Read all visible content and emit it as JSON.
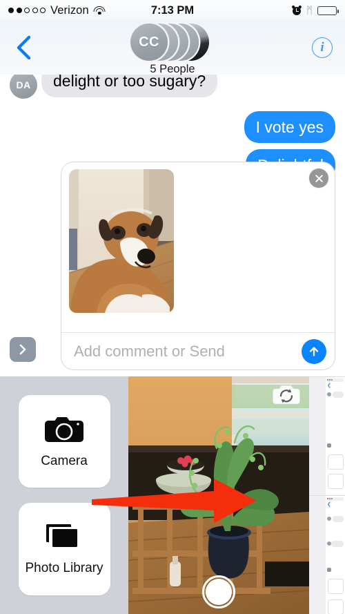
{
  "status_bar": {
    "carrier": "Verizon",
    "signal_dots_filled": 2,
    "signal_dots_total": 5,
    "wifi_icon": "wifi-icon",
    "time": "7:13 PM",
    "alarm_icon": "alarm-clock-icon",
    "bluetooth_icon": "bluetooth-icon",
    "bluetooth_glyph": "ᛗ",
    "battery_icon": "battery-low-icon",
    "battery_percent": 15,
    "battery_color": "#ef3a36"
  },
  "nav_bar": {
    "back_icon": "back-chevron-icon",
    "back_color": "#0a84ff",
    "info_icon": "info-circle-icon",
    "info_glyph": "i",
    "info_color": "#3f9bf2",
    "group_avatar_initials": "CC",
    "group_title": "5 People",
    "avatar_count": 5
  },
  "conversation": {
    "messages": [
      {
        "id": "msg-incoming-1",
        "direction": "incoming",
        "avatar_initials": "DA",
        "text": "delight or too sugary?",
        "clipped_top": true
      },
      {
        "id": "msg-outgoing-1",
        "direction": "outgoing",
        "text": "I vote yes"
      },
      {
        "id": "msg-outgoing-2",
        "direction": "outgoing",
        "text": "Delightful"
      }
    ],
    "bubble_colors": {
      "incoming": "#e5e5ea",
      "outgoing": "#1d8fff"
    }
  },
  "composer": {
    "apps_drawer_icon": "chevron-right-icon",
    "attachment": {
      "thumbnail_alt": "dog-photo-thumbnail",
      "remove_icon": "close-x-icon"
    },
    "input_placeholder": "Add comment or Send",
    "input_value": "",
    "send_icon": "send-arrow-up-icon",
    "send_color": "#0a84ff"
  },
  "photo_tray": {
    "background_color": "#ced2d8",
    "actions": [
      {
        "id": "camera",
        "icon": "camera-icon",
        "label": "Camera"
      },
      {
        "id": "photo-library",
        "icon": "photo-library-icon",
        "label": "Photo Library"
      }
    ],
    "viewfinder": {
      "alt": "live-camera-viewfinder-houseplant",
      "flip_icon": "camera-flip-icon",
      "shutter_icon": "shutter-button-icon"
    },
    "recent_thumbnails": [
      {
        "id": "recent-screenshot-1",
        "alt": "messages-screenshot-thumbnail"
      },
      {
        "id": "recent-screenshot-2",
        "alt": "messages-screenshot-thumbnail"
      }
    ]
  },
  "annotation": {
    "arrow_color": "#f42d0c",
    "arrow_direction": "right",
    "points_to": "viewfinder"
  }
}
